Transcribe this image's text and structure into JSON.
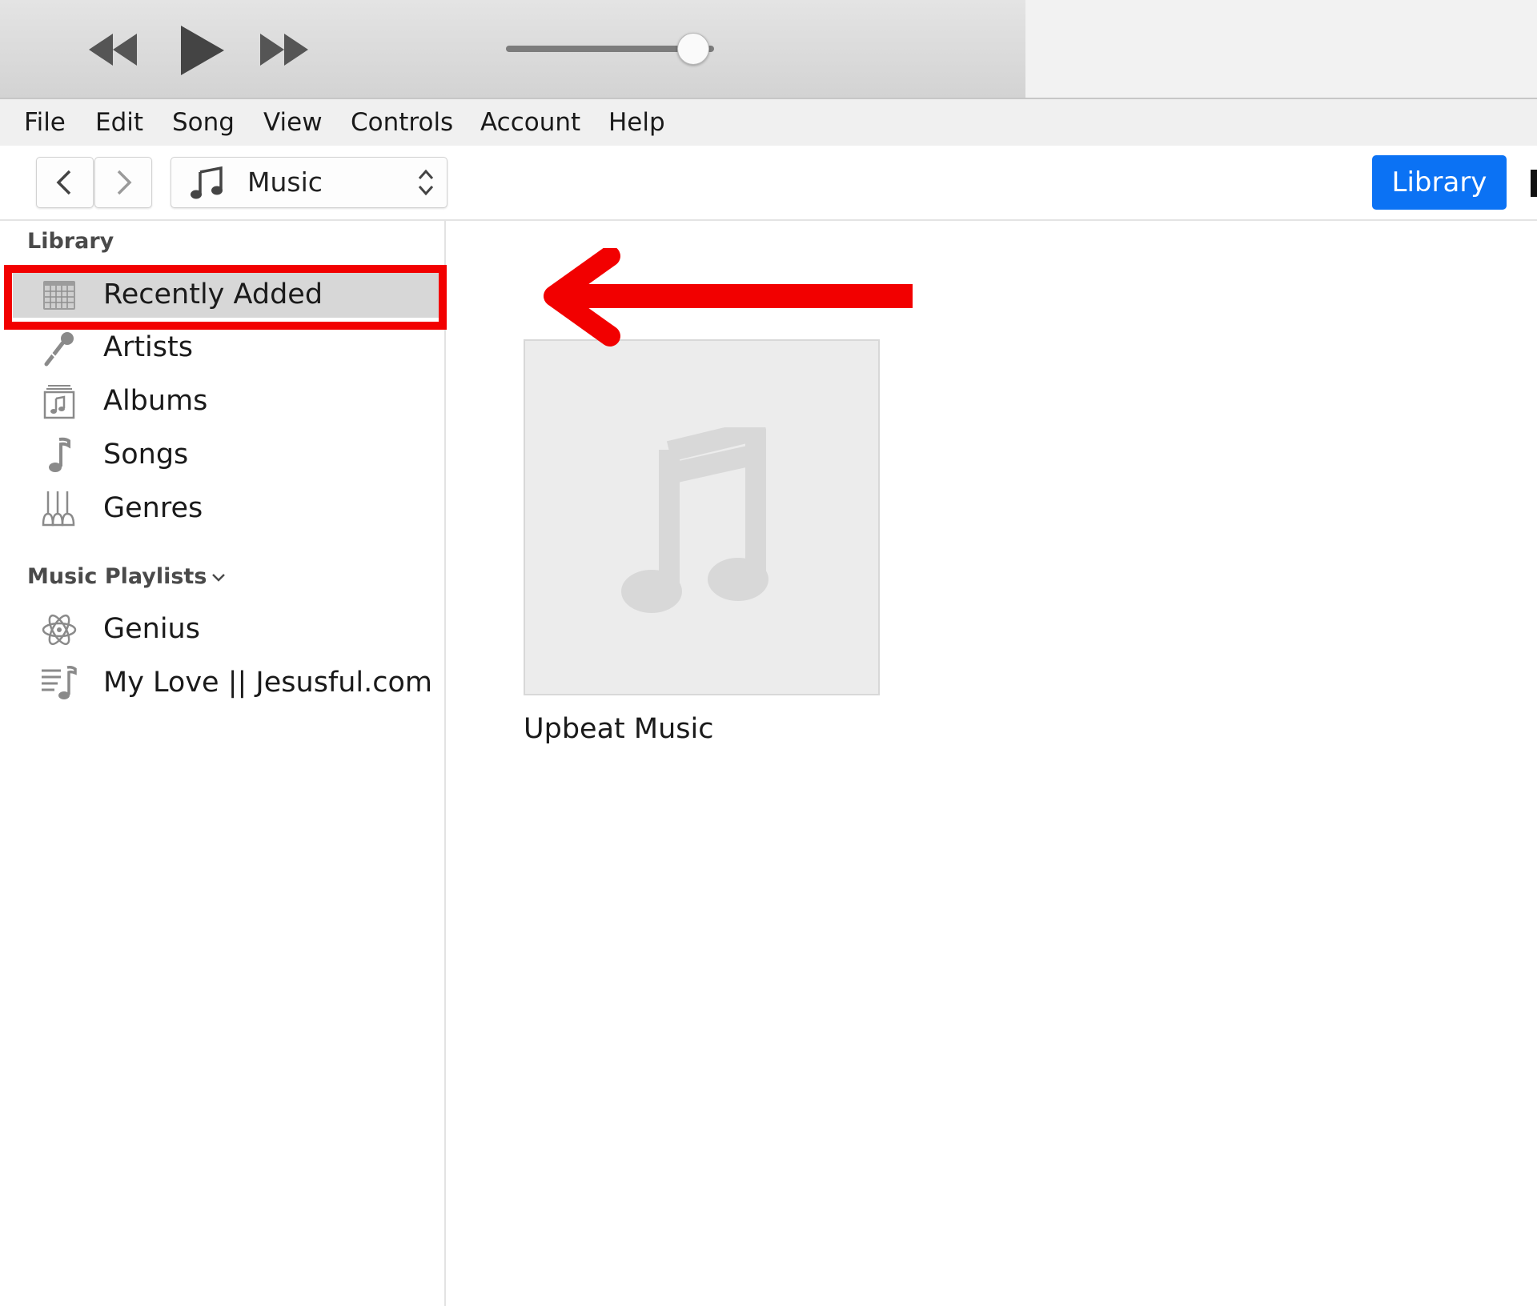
{
  "player": {
    "prev_icon": "rewind-icon",
    "play_icon": "play-icon",
    "next_icon": "fast-forward-icon",
    "volume_level": 0.9
  },
  "menu": [
    "File",
    "Edit",
    "Song",
    "View",
    "Controls",
    "Account",
    "Help"
  ],
  "toolbar": {
    "media_type": "Music",
    "library_label": "Library",
    "accent_color": "#0b72f4"
  },
  "sidebar": {
    "library_header": "Library",
    "library_items": [
      {
        "label": "Recently Added",
        "icon": "calendar-grid-icon",
        "selected": true
      },
      {
        "label": "Artists",
        "icon": "microphone-icon"
      },
      {
        "label": "Albums",
        "icon": "album-icon"
      },
      {
        "label": "Songs",
        "icon": "music-note-icon"
      },
      {
        "label": "Genres",
        "icon": "guitars-icon"
      }
    ],
    "playlists_header": "Music Playlists",
    "playlist_items": [
      {
        "label": "Genius",
        "icon": "atom-icon"
      },
      {
        "label": "My Love || Jesusful.com",
        "icon": "playlist-icon"
      }
    ]
  },
  "content": {
    "albums": [
      {
        "title": "Upbeat Music",
        "artwork": "music-note-placeholder-icon"
      }
    ]
  },
  "annotation": {
    "color": "#f20000",
    "target": "Recently Added"
  }
}
